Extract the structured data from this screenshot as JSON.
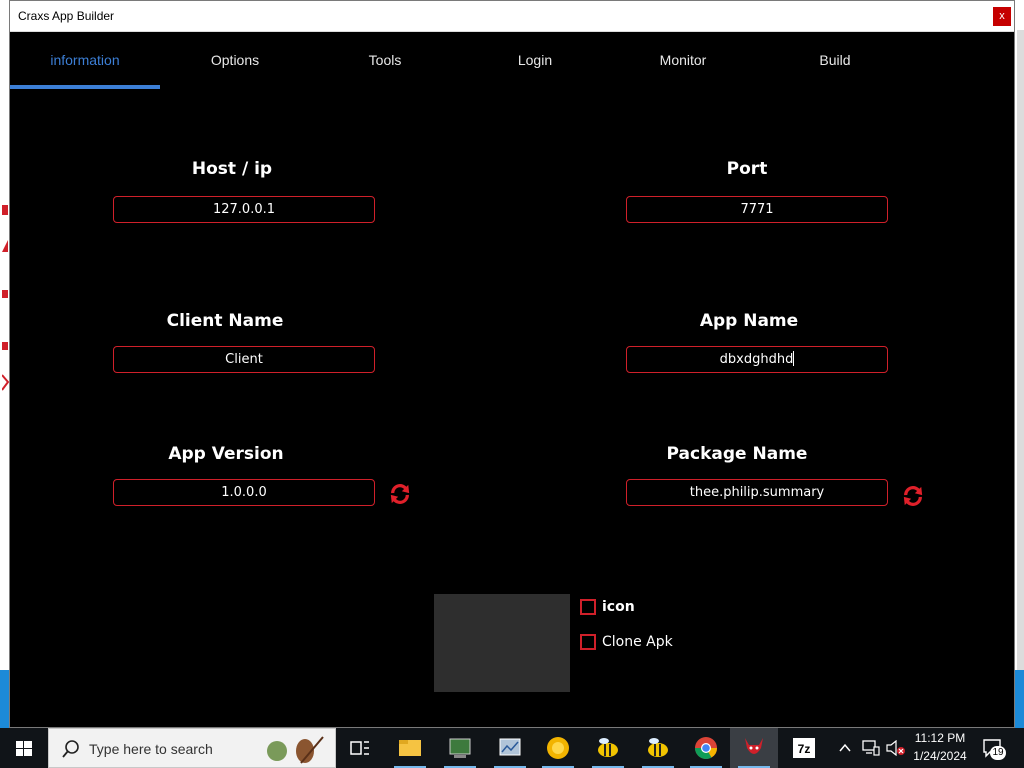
{
  "window": {
    "title": "Craxs App Builder",
    "close_label": "x"
  },
  "tabs": [
    {
      "label": "information",
      "active": true
    },
    {
      "label": "Options",
      "active": false
    },
    {
      "label": "Tools",
      "active": false
    },
    {
      "label": "Login",
      "active": false
    },
    {
      "label": "Monitor",
      "active": false
    },
    {
      "label": "Build",
      "active": false
    }
  ],
  "form": {
    "host_label": "Host / ip",
    "host_value": "127.0.0.1",
    "port_label": "Port",
    "port_value": "7771",
    "client_label": "Client Name",
    "client_value": "Client",
    "appname_label": "App Name",
    "appname_value": "dbxdghdhd",
    "version_label": "App Version",
    "version_value": "1.0.0.0",
    "package_label": "Package Name",
    "package_value": "thee.philip.summary"
  },
  "options": {
    "icon_label": "icon",
    "icon_checked": false,
    "clone_label": "Clone Apk",
    "clone_checked": false
  },
  "colors": {
    "accent": "#3c7fd6",
    "field_border": "#d0202a",
    "window_bg": "#000000"
  },
  "taskbar": {
    "search_placeholder": "Type here to search",
    "time": "11:12 PM",
    "date": "1/24/2024",
    "notification_count": "19"
  }
}
